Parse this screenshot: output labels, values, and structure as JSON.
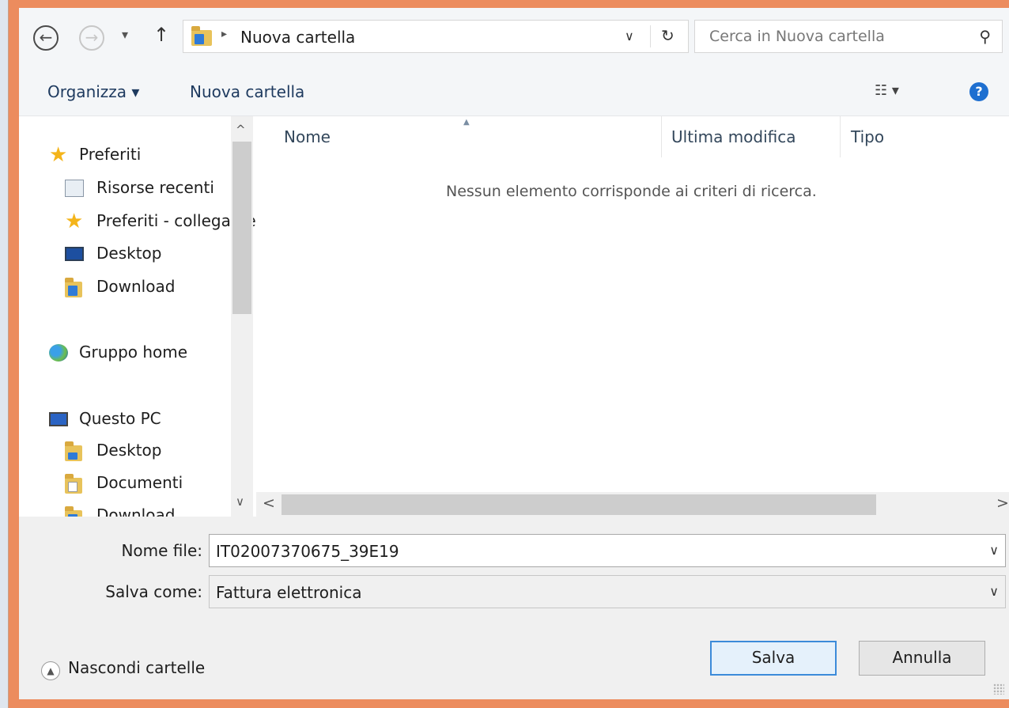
{
  "address_bar": {
    "back_glyph": "←",
    "forward_glyph": "→",
    "recent_dropdown_glyph": "▾",
    "up_glyph": "↑",
    "path_separator": "▸",
    "path_folder": "Nuova cartella",
    "path_dropdown_glyph": "∨",
    "refresh_glyph": "↻",
    "search_placeholder": "Cerca in Nuova cartella",
    "search_glyph": "⚲"
  },
  "toolbar": {
    "organize_label": "Organizza ▾",
    "new_folder_label": "Nuova cartella",
    "view_glyph": "☷ ▾",
    "help_glyph": "?"
  },
  "navigation": {
    "scroll_up_glyph": "^",
    "scroll_down_glyph": "∨",
    "items": [
      {
        "label": "Preferiti",
        "icon": "star-icon"
      },
      {
        "label": "Risorse recenti",
        "icon": "recent-places-icon"
      },
      {
        "label": "Preferiti - collegamenti",
        "icon": "star-icon"
      },
      {
        "label": "Desktop",
        "icon": "desktop-icon"
      },
      {
        "label": "Download",
        "icon": "download-folder-icon"
      },
      {
        "label": "Gruppo home",
        "icon": "homegroup-icon"
      },
      {
        "label": "Questo PC",
        "icon": "computer-icon"
      },
      {
        "label": "Desktop",
        "icon": "desktop-folder-icon"
      },
      {
        "label": "Documenti",
        "icon": "documents-folder-icon"
      },
      {
        "label": "Download",
        "icon": "download-folder-icon"
      }
    ]
  },
  "file_list": {
    "columns": [
      "Nome",
      "Ultima modifica",
      "Tipo"
    ],
    "sort_glyph": "▲",
    "empty_message": "Nessun elemento corrisponde ai criteri di ricerca.",
    "scroll_left_glyph": "<",
    "scroll_right_glyph": ">"
  },
  "form": {
    "filename_label": "Nome file:",
    "filename_value": "IT02007370675_39E19",
    "savetype_label": "Salva come:",
    "savetype_value": "Fattura elettronica",
    "dropdown_glyph": "∨"
  },
  "footer": {
    "hide_folders_label": "Nascondi cartelle",
    "hide_glyph": "▲",
    "save_label": "Salva",
    "cancel_label": "Annulla"
  },
  "colors": {
    "window_border": "#ec8c5e",
    "primary_button_border": "#3c8bd9",
    "folder_yellow": "#e8c35b",
    "star_gold": "#f4b41a"
  }
}
